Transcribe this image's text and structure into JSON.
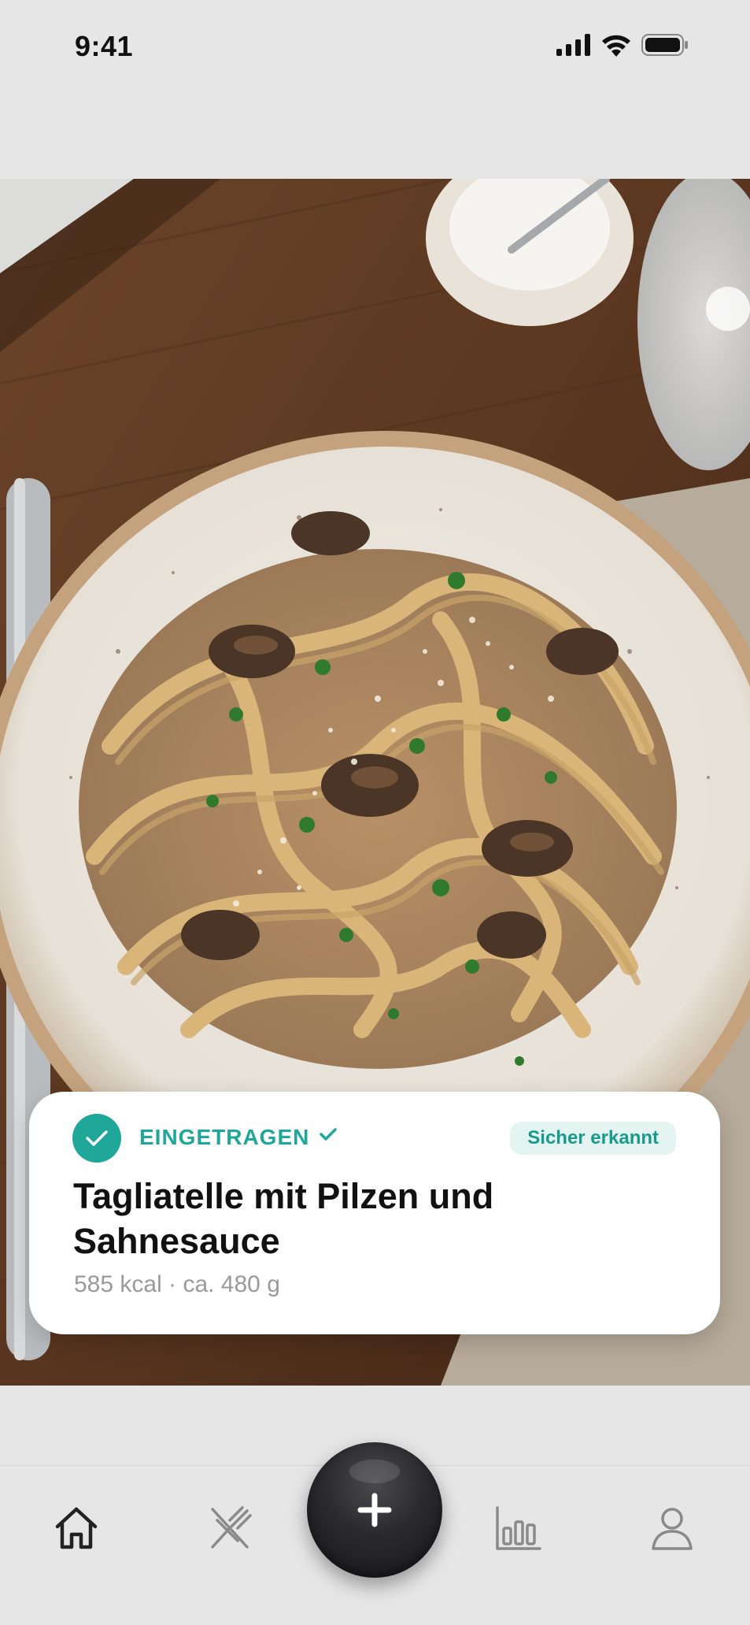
{
  "status_bar": {
    "time": "9:41",
    "icons": [
      "signal-icon",
      "wifi-icon",
      "battery-icon"
    ]
  },
  "photo": {
    "subject_icon": "pasta-photo"
  },
  "result_card": {
    "status_label": "EINGETRAGEN",
    "confidence_badge": "Sicher erkannt",
    "food_name": "Tagliatelle mit Pilzen und Sahnesauce",
    "calories_value": "585",
    "calories_unit": "kcal",
    "separator": "·",
    "weight": "ca. 480 g",
    "accent_color": "#1fa89a"
  },
  "bottom_nav": {
    "items": [
      {
        "icon": "home-icon",
        "active": true
      },
      {
        "icon": "cutlery-icon",
        "active": false
      },
      {
        "icon": "plus-icon",
        "active": false
      },
      {
        "icon": "bar-chart-icon",
        "active": false
      },
      {
        "icon": "profile-icon",
        "active": false
      }
    ]
  }
}
